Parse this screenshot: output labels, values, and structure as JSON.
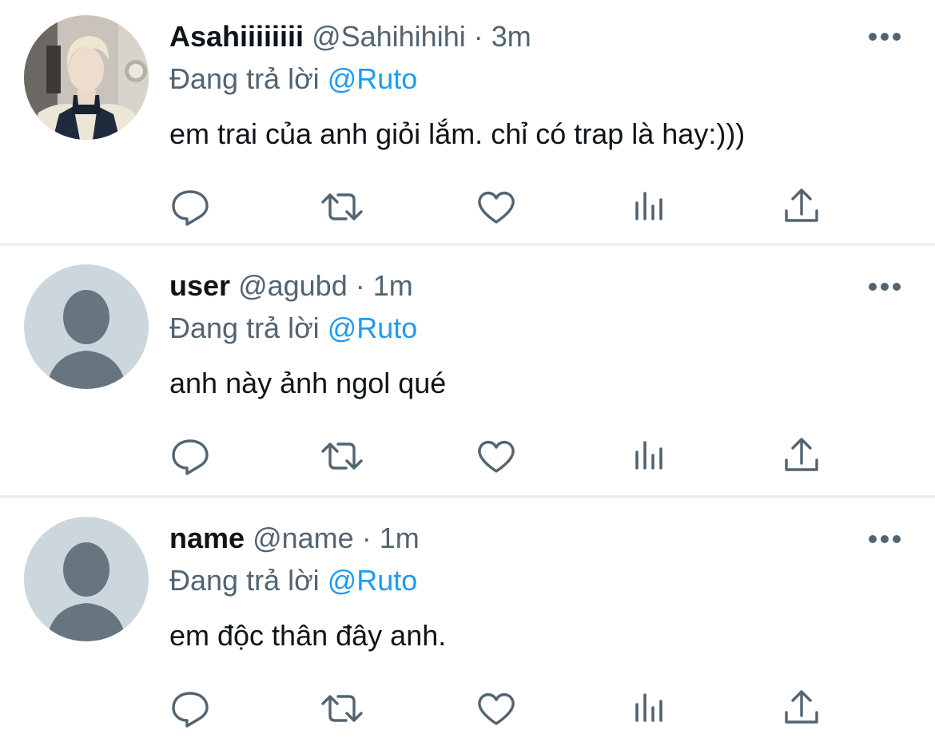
{
  "tweets": [
    {
      "name": "Asahiiiiiiii",
      "handle": "@Sahihihihi",
      "dot": "·",
      "time": "3m",
      "replying_prefix": "Đang trả lời",
      "replying_to": "@Ruto",
      "text": "em trai của anh giỏi lắm. chỉ có trap là hay:)))",
      "avatar": "photo"
    },
    {
      "name": "user",
      "handle": "@agubd",
      "dot": "·",
      "time": "1m",
      "replying_prefix": "Đang trả lời",
      "replying_to": "@Ruto",
      "text": "anh này ảnh ngol qué",
      "avatar": "default"
    },
    {
      "name": "name",
      "handle": "@name",
      "dot": "·",
      "time": "1m",
      "replying_prefix": "Đang trả lời",
      "replying_to": "@Ruto",
      "text": "em độc thân đây anh.",
      "avatar": "default"
    }
  ],
  "icons": {
    "more": "more-horizontal-icon",
    "reply": "reply-icon",
    "retweet": "retweet-icon",
    "like": "heart-icon",
    "views": "bar-chart-icon",
    "share": "share-icon"
  },
  "colors": {
    "text": "#0f1419",
    "secondary": "#536471",
    "mention": "#1d9bf0",
    "separator": "#eceef0",
    "default_avatar_bg": "#ccd6dd",
    "default_avatar_fg": "#66757f"
  }
}
